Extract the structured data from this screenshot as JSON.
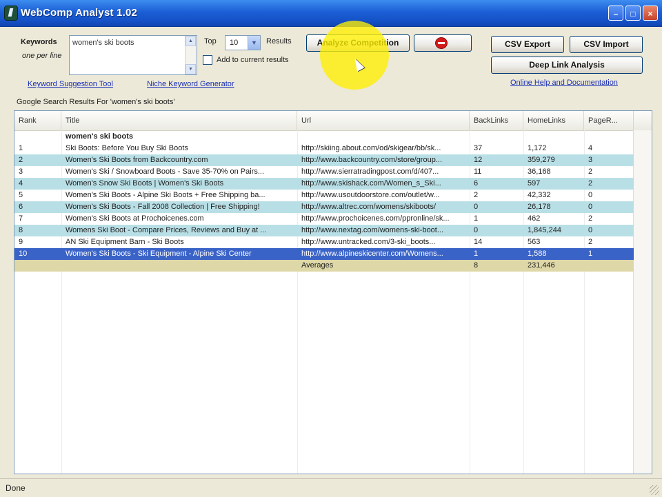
{
  "window": {
    "title": "WebComp Analyst 1.02"
  },
  "controls": {
    "keywords_label": "Keywords",
    "keywords_hint": "one per line",
    "keywords_value": "women's ski boots",
    "top_label": "Top",
    "top_value": "10",
    "results_label": "Results",
    "add_to_current": "Add to current results",
    "analyze_button": "Analyze Competition",
    "csv_export": "CSV Export",
    "csv_import": "CSV Import",
    "deep_link": "Deep Link Analysis",
    "keyword_suggestion_link": "Keyword Suggestion Tool",
    "niche_keyword_link": "Niche Keyword Generator",
    "help_link": "Online Help and Documentation",
    "search_results_caption": "Google Search Results For 'women's ski boots'"
  },
  "table": {
    "columns": [
      "Rank",
      "Title",
      "Url",
      "BackLinks",
      "HomeLinks",
      "PageR..."
    ],
    "group_label": "women's ski boots",
    "rows": [
      {
        "rank": "1",
        "title": "Ski Boots: Before You Buy Ski Boots",
        "url": "http://skiing.about.com/od/skigear/bb/sk...",
        "backlinks": "37",
        "homelinks": "1,172",
        "pagerank": "4"
      },
      {
        "rank": "2",
        "title": "Women's Ski Boots from Backcountry.com",
        "url": "http://www.backcountry.com/store/group...",
        "backlinks": "12",
        "homelinks": "359,279",
        "pagerank": "3"
      },
      {
        "rank": "3",
        "title": "Women's Ski / Snowboard Boots - Save 35-70% on Pairs...",
        "url": "http://www.sierratradingpost.com/d/407...",
        "backlinks": "11",
        "homelinks": "36,168",
        "pagerank": "2"
      },
      {
        "rank": "4",
        "title": "Women's Snow Ski Boots | Women's Ski Boots",
        "url": "http://www.skishack.com/Women_s_Ski...",
        "backlinks": "6",
        "homelinks": "597",
        "pagerank": "2"
      },
      {
        "rank": "5",
        "title": "Women's Ski Boots - Alpine Ski Boots + Free Shipping ba...",
        "url": "http://www.usoutdoorstore.com/outlet/w...",
        "backlinks": "2",
        "homelinks": "42,332",
        "pagerank": "0"
      },
      {
        "rank": "6",
        "title": "Women's Ski Boots - Fall 2008 Collection | Free Shipping!",
        "url": "http://www.altrec.com/womens/skiboots/",
        "backlinks": "0",
        "homelinks": "26,178",
        "pagerank": "0"
      },
      {
        "rank": "7",
        "title": "Women's Ski Boots at Prochoicenes.com",
        "url": "http://www.prochoicenes.com/ppronline/sk...",
        "backlinks": "1",
        "homelinks": "462",
        "pagerank": "2"
      },
      {
        "rank": "8",
        "title": "Womens Ski Boot - Compare Prices, Reviews and Buy at ...",
        "url": "http://www.nextag.com/womens-ski-boot...",
        "backlinks": "0",
        "homelinks": "1,845,244",
        "pagerank": "0"
      },
      {
        "rank": "9",
        "title": "AN Ski Equipment Barn - Ski Boots",
        "url": "http://www.untracked.com/3-ski_boots...",
        "backlinks": "14",
        "homelinks": "563",
        "pagerank": "2"
      },
      {
        "rank": "10",
        "title": "Women's Ski Boots - Ski Equipment - Alpine Ski Center",
        "url": "http://www.alpineskicenter.com/Womens...",
        "backlinks": "1",
        "homelinks": "1,588",
        "pagerank": "1"
      }
    ],
    "averages_label": "Averages",
    "averages_backlinks": "8",
    "averages_homelinks": "231,446"
  },
  "statusbar": {
    "text": "Done"
  },
  "colors": {
    "titlebar": "#1c5fd6",
    "row_alt": "#b9dfe6",
    "row_selected": "#3a63c8",
    "averages_row": "#ded8a8",
    "highlight": "#fff000"
  }
}
